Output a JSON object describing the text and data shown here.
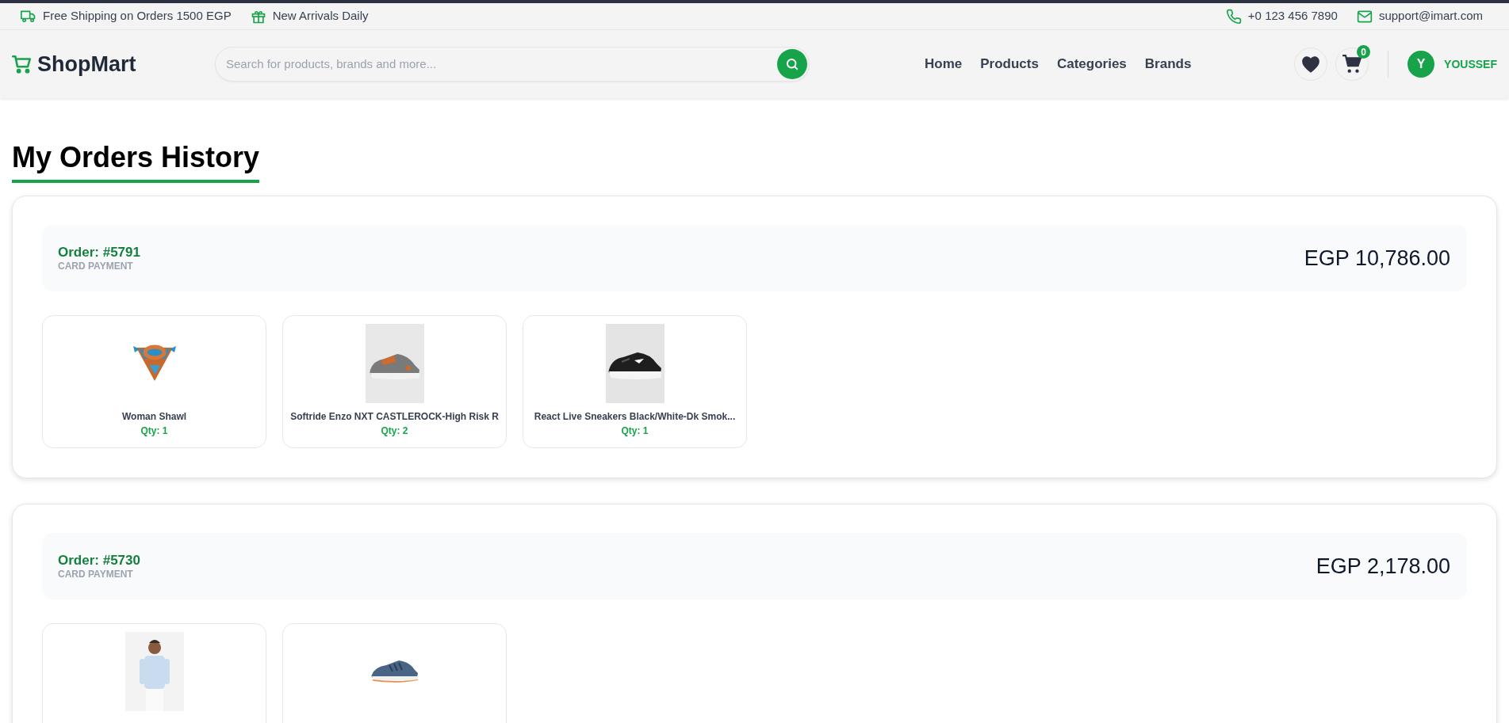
{
  "top_bar": {
    "promos": [
      {
        "kind": "truck",
        "text": "Free Shipping on Orders 1500 EGP"
      },
      {
        "kind": "gift",
        "text": "New Arrivals Daily"
      }
    ],
    "contacts": [
      {
        "kind": "phone",
        "text": "+0 123 456 7890"
      },
      {
        "kind": "mail",
        "text": "support@imart.com"
      }
    ]
  },
  "header": {
    "logo": "ShopMart",
    "search": {
      "placeholder": "Search for products, brands and more..."
    },
    "nav": [
      "Home",
      "Products",
      "Categories",
      "Brands"
    ],
    "cart_count": "0",
    "user": {
      "initial": "Y",
      "name": "YOUSSEF"
    }
  },
  "page_title": "My Orders History",
  "orders": [
    {
      "number": "Order: #5791",
      "payment": "CARD PAYMENT",
      "total": "EGP 10,786.00",
      "items": [
        {
          "kind": "picture",
          "name": "Woman Shawl",
          "qty": "Qty: 1"
        },
        {
          "kind": "picture",
          "name": "Softride Enzo NXT CASTLEROCK-High Risk R",
          "qty": "Qty: 2"
        },
        {
          "kind": "picture",
          "name": "React Live Sneakers Black/White-Dk Smok...",
          "qty": "Qty: 1"
        }
      ]
    },
    {
      "number": "Order: #5730",
      "payment": "CARD PAYMENT",
      "total": "EGP 2,178.00"
    }
  ]
}
